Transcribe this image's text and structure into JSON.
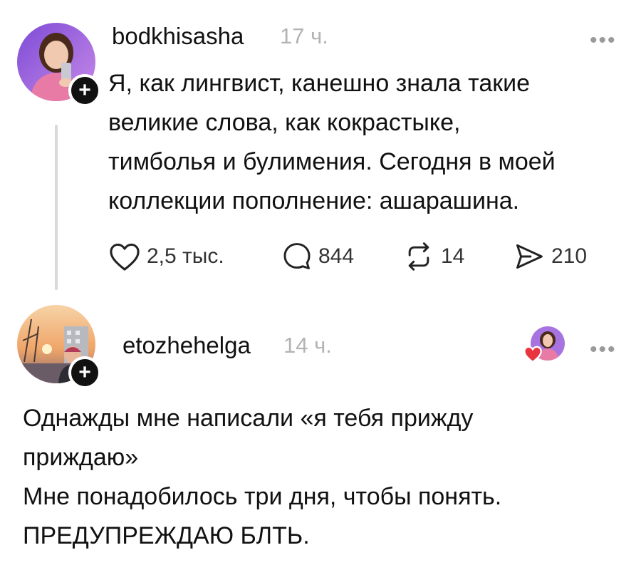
{
  "posts": [
    {
      "username": "bodkhisasha",
      "time": "17 ч.",
      "text_lines": [
        "Я, как лингвист, канешно знала такие",
        "великие слова, как кокрастыке,",
        "тимболья и булимения. Сегодня в моей",
        "коллекции пополнение: ашарашина."
      ],
      "actions": {
        "likes": "2,5 тыс.",
        "comments": "844",
        "reposts": "14",
        "shares": "210"
      }
    },
    {
      "username": "etozhehelga",
      "time": "14 ч.",
      "text_lines": [
        "Однажды мне написали «я тебя прижду",
        "приждаю»",
        "Мне понадобилось три дня, чтобы понять.",
        "ПРЕДУПРЕЖДАЮ БЛТЬ."
      ]
    }
  ],
  "more_label": "•••",
  "plus_label": "+",
  "icons": {
    "heart": "heart-outline",
    "comment": "speech-bubble",
    "repost": "repost-arrows",
    "share": "paper-plane"
  },
  "colors": {
    "text": "#111111",
    "muted": "#b3b3b3",
    "heart_red": "#e8343f"
  }
}
